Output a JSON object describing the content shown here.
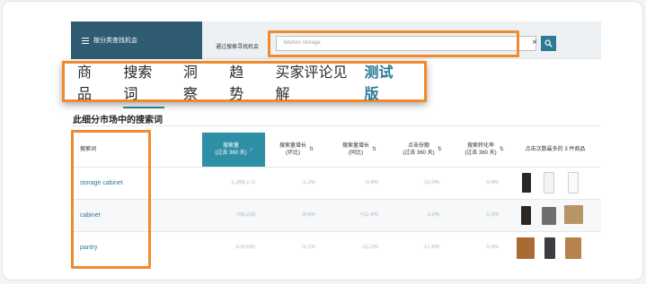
{
  "header": {
    "nav_label": "按分类查找机会",
    "search_label": "通过搜索寻找机会",
    "search_value": "kitchen storage"
  },
  "tabs": {
    "items": [
      "商品",
      "搜索词",
      "洞察",
      "趋势",
      "买家评论见解"
    ],
    "beta": "测试版",
    "active_index": 1
  },
  "section": {
    "title": "此细分市场中的搜索词"
  },
  "table": {
    "headers": {
      "keyword": "搜索词",
      "volume": "搜索量",
      "volume_sub": "(过去 360 天)",
      "growth_yoy": "搜索量增长",
      "growth_yoy_sub": "(环比)",
      "growth_prev": "搜索量增长",
      "growth_prev_sub": "(同比)",
      "click_share": "点击份额",
      "click_share_sub": "(过去 360 天)",
      "conversion": "搜索转化率",
      "conversion_sub": "(过去 360 天)",
      "top_clicked": "点击次数最多的 3 件商品"
    },
    "rows": [
      {
        "keyword": "storage cabinet",
        "volume": "1,289,173",
        "growth_yoy": "-1.3%",
        "growth_prev": "-3.9%",
        "click_share": "25.0%",
        "conversion": "0.4%"
      },
      {
        "keyword": "cabinet",
        "volume": "706,218",
        "growth_yoy": "-8.6%",
        "growth_prev": "+11.4%",
        "click_share": "3.2%",
        "conversion": "0.3%"
      },
      {
        "keyword": "pantry",
        "volume": "378,535",
        "growth_yoy": "-5.1%",
        "growth_prev": "-22.2%",
        "click_share": "17.6%",
        "conversion": "0.4%"
      }
    ]
  },
  "colors": {
    "accent": "#2c7a95",
    "nav_bg": "#2f5c72",
    "highlight": "#f08a2c",
    "active_header": "#2f8fa6"
  }
}
